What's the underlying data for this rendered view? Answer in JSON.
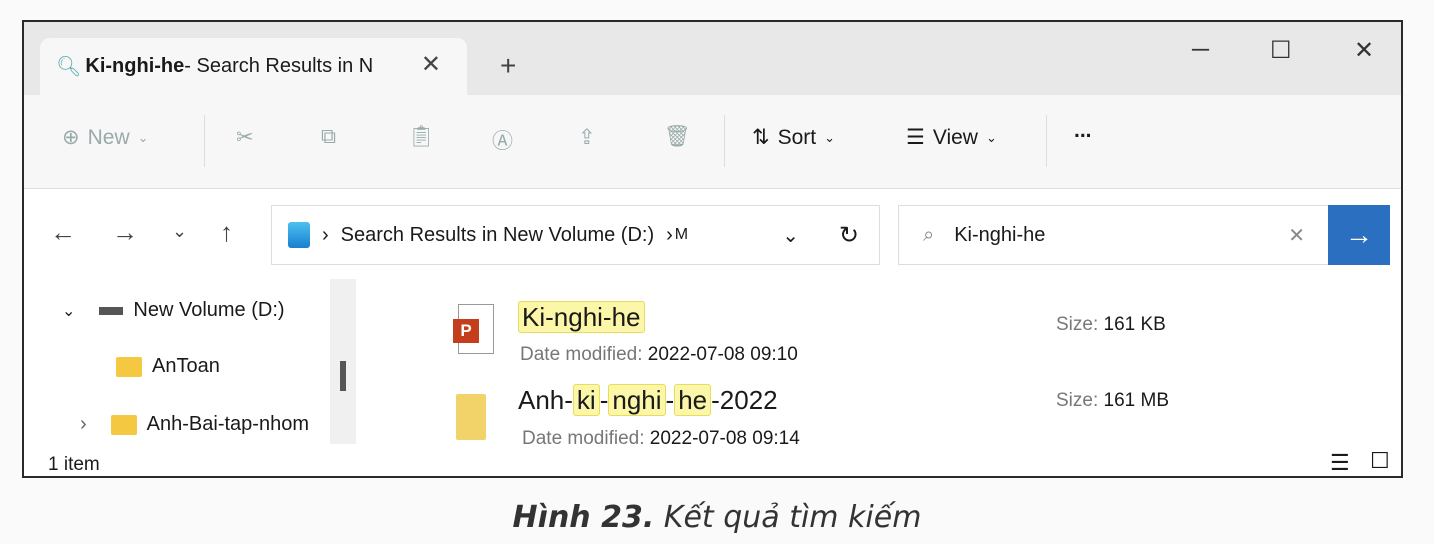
{
  "tab": {
    "title_bold": "Ki-nghi-he",
    "title_rest": " - Search Results in N"
  },
  "toolbar": {
    "new": "New",
    "sort": "Sort",
    "view": "View",
    "more": "..."
  },
  "address": {
    "path": "Search Results in New Volume (D:)",
    "overflow": "M"
  },
  "search": {
    "value": "Ki-nghi-he"
  },
  "tree": [
    {
      "label": "New Volume (D:)"
    },
    {
      "label": "AnToan"
    },
    {
      "label": "Anh-Bai-tap-nhom"
    }
  ],
  "results": [
    {
      "name_segments": [
        {
          "t": "Ki-nghi-he",
          "h": true
        }
      ],
      "date_label": "Date modified:",
      "date": "2022-07-08 09:10",
      "size_label": "Size:",
      "size": "161 KB",
      "icon": "powerpoint-icon"
    },
    {
      "name_segments": [
        {
          "t": "Anh-",
          "h": false
        },
        {
          "t": "ki",
          "h": true
        },
        {
          "t": "-",
          "h": false
        },
        {
          "t": "nghi",
          "h": true
        },
        {
          "t": "-",
          "h": false
        },
        {
          "t": "he",
          "h": true
        },
        {
          "t": "-2022",
          "h": false
        }
      ],
      "date_label": "Date modified:",
      "date": "2022-07-08 09:14",
      "size_label": "Size:",
      "size": "161 MB",
      "icon": "folder-icon"
    }
  ],
  "status": {
    "count": "1 item"
  },
  "caption": {
    "label": "Hình 23.",
    "text": " Kết quả tìm kiếm"
  },
  "colors": {
    "highlight": "#fbf6a8",
    "accent": "#2a6fc0"
  }
}
